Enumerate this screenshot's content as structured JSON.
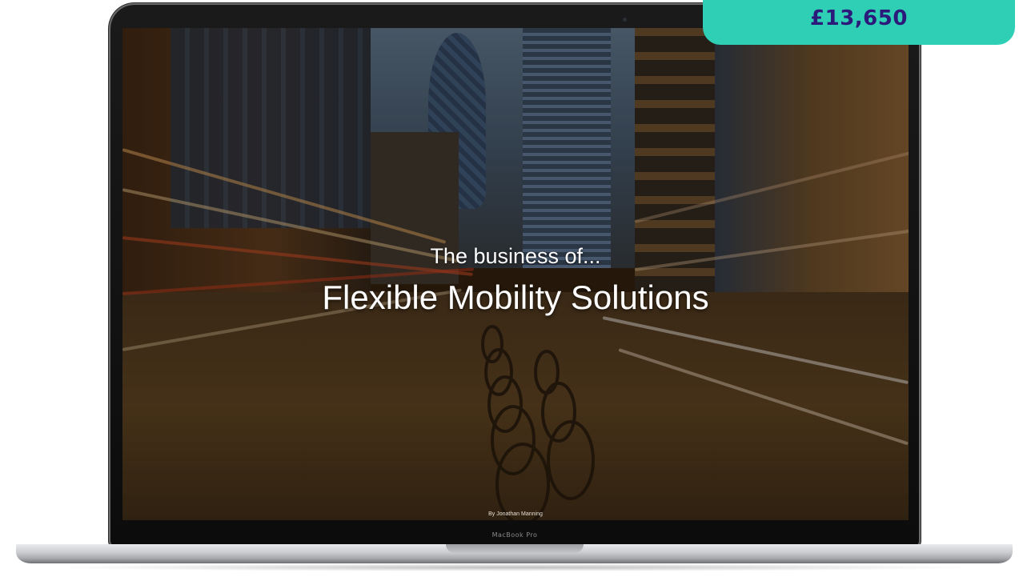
{
  "price_badge": {
    "price": "£13,650",
    "color": "#2ecfb5",
    "text_color": "#2b1a7a"
  },
  "slide": {
    "subtitle": "The business of...",
    "title": "Flexible Mobility Solutions",
    "byline": "By Jonathan Manning"
  },
  "laptop": {
    "label": "MacBook Pro"
  }
}
